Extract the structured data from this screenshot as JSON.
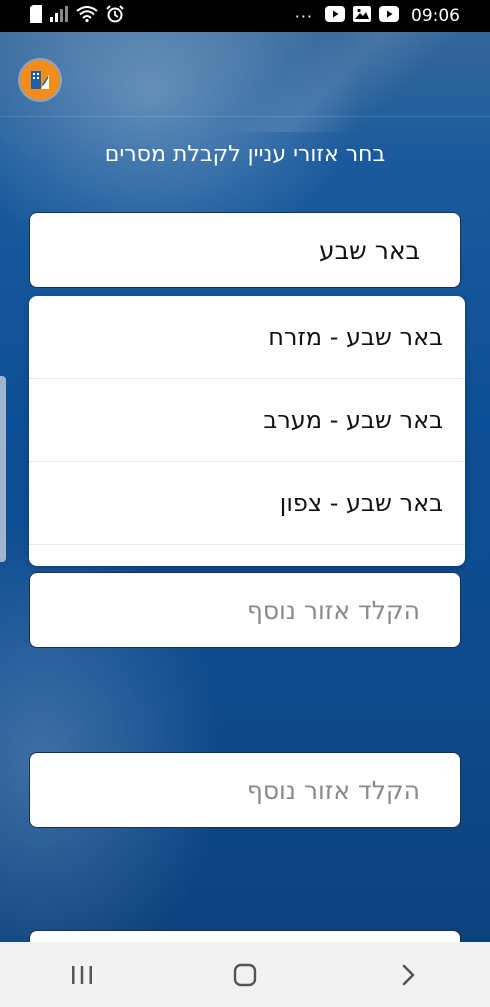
{
  "status_bar": {
    "time": "09:06",
    "overflow_dots": "···",
    "icons_left": [
      "sim-card-icon",
      "signal-icon",
      "wifi-icon",
      "alarm-icon"
    ],
    "icons_right": [
      "youtube-icon",
      "gallery-icon",
      "youtube-icon"
    ]
  },
  "header": {
    "logo_icon": "app-logo-icon"
  },
  "page": {
    "title": "בחר אזורי עניין לקבלת מסרים"
  },
  "fields": {
    "primary_value": "באר שבע",
    "additional_placeholder_1": "הקלד אזור נוסף",
    "additional_placeholder_2": "הקלד אזור נוסף"
  },
  "dropdown": {
    "options": [
      "באר שבע - מזרח",
      "באר שבע - מערב",
      "באר שבע - צפון"
    ]
  },
  "nav_bar": {
    "icons": [
      "recent-apps-icon",
      "home-icon",
      "back-icon"
    ]
  },
  "colors": {
    "logo_bg": "#f28c1c",
    "background_blue": "#0d4f96"
  }
}
